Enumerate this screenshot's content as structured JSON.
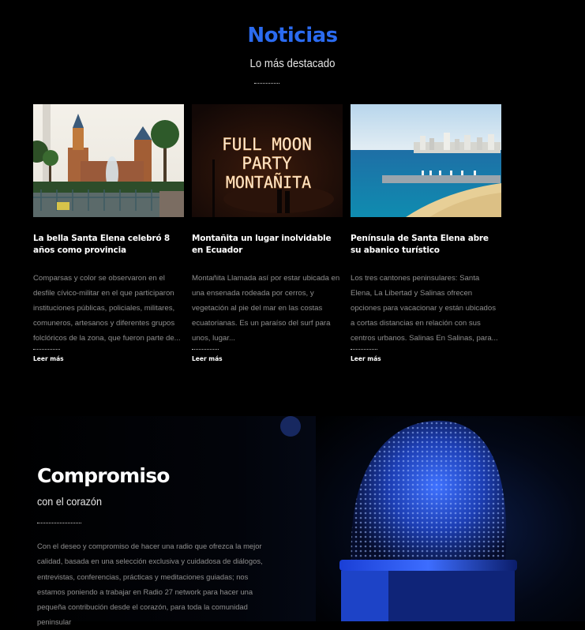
{
  "news": {
    "title": "Noticias",
    "subtitle": "Lo más destacado",
    "cards": [
      {
        "title": "La bella Santa Elena celebró 8 años como provincia",
        "excerpt": "Comparsas y color se observaron en el desfile cívico-militar en el que participaron instituciones públicas, policiales, militares, comuneros, artesanos y diferentes grupos folclóricos de la zona, que fueron parte de...",
        "link": "Leer más"
      },
      {
        "title": "Montañita un lugar inolvidable en Ecuador",
        "excerpt": "Montañita Llamada así por estar ubicada en una ensenada rodeada por cerros, y vegetación al pie del mar en las costas ecuatorianas. Es un paraíso del surf para unos, lugar...",
        "link": "Leer más",
        "image_text": "FULL MOON PARTY MONTAÑITA"
      },
      {
        "title": "Península de Santa Elena abre su abanico turístico",
        "excerpt": "Los tres cantones peninsulares: Santa Elena, La Libertad y Salinas ofrecen opciones para vacacionar y están ubicados a cortas distancias en relación con sus centros urbanos. Salinas En Salinas, para...",
        "link": "Leer más"
      }
    ]
  },
  "commitment": {
    "title": "Compromiso",
    "subtitle": "con el corazón",
    "text": "Con el deseo y compromiso de hacer una radio que ofrezca la mejor calidad, basada en una selección exclusiva y cuidadosa de diálogos, entrevistas, conferencias, prácticas y meditaciones guiadas; nos estamos poniendo a trabajar en Radio 27 network para hacer una pequeña contribución desde el corazón, para toda la comunidad peninsular"
  },
  "colors": {
    "accent": "#2b6bf0",
    "background": "#000000",
    "body_text": "#8f8f8f"
  }
}
